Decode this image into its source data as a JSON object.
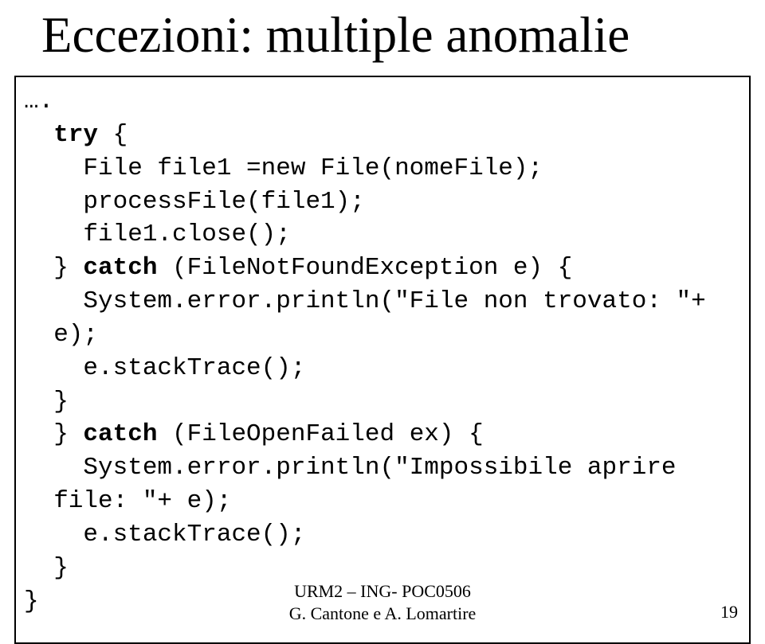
{
  "title": "Eccezioni: multiple anomalie",
  "code": {
    "l1a": "….",
    "l2a": "  ",
    "l2b": "try",
    "l2c": " {",
    "l3": "    File file1 =new File(nomeFile);",
    "l4": "    processFile(file1);",
    "l5": "    file1.close();",
    "l6a": "  } ",
    "l6b": "catch",
    "l6c": " (FileNotFoundException e) {",
    "l7": "    System.error.println(\"File non trovato: \"+",
    "l8": "  e);",
    "l9": "    e.stackTrace();",
    "l10": "  }",
    "l11a": "  } ",
    "l11b": "catch",
    "l11c": " (FileOpenFailed ex) {",
    "l12": "    System.error.println(\"Impossibile aprire",
    "l13": "  file: \"+ e);",
    "l14": "    e.stackTrace();",
    "l15": "  }",
    "l16": "}"
  },
  "footer": {
    "line1": "URM2 – ING- POC0506",
    "line2": "G. Cantone e A. Lomartire",
    "page": "19"
  }
}
